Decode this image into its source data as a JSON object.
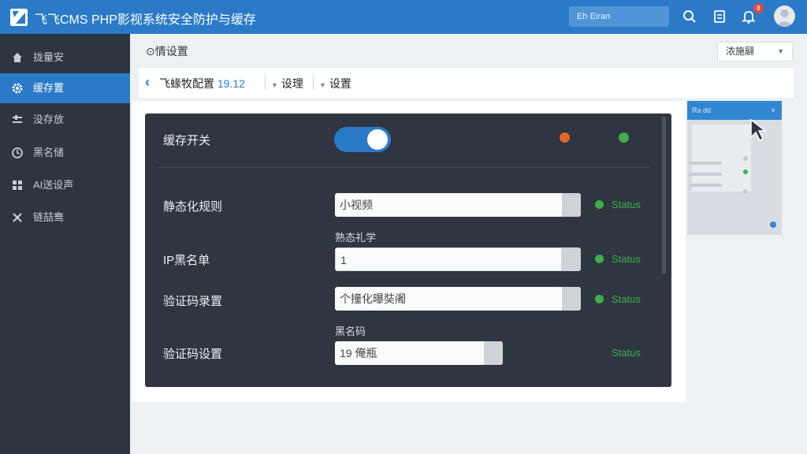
{
  "app": {
    "title": "飞飞CMS PHP影视系统安全防护与缓存"
  },
  "topbar": {
    "search_text": "Eh Eiran",
    "notification_count": "8"
  },
  "sidebar": {
    "items": [
      {
        "label": "拢量安",
        "icon": "home-icon",
        "active": false
      },
      {
        "label": "缓存置",
        "icon": "gear-icon",
        "active": true
      },
      {
        "label": "没存放",
        "icon": "sliders-icon",
        "active": false
      },
      {
        "label": "黑名储",
        "icon": "clock-icon",
        "active": false
      },
      {
        "label": "AI送设声",
        "icon": "grid-icon",
        "active": false
      },
      {
        "label": "链喆鸯",
        "icon": "tools-icon",
        "active": false
      }
    ]
  },
  "header": {
    "page_title": "⊙情设置",
    "select_value": "浓施翮",
    "breadcrumb": {
      "main": "飞蝝牧配置",
      "version": "19.12",
      "item1": "设理",
      "item2": "设置"
    }
  },
  "preview": {
    "head_text": "Ra dd"
  },
  "settings": {
    "cache_switch_label": "缓存开关",
    "cache_switch_on": true,
    "dots": {
      "left_color": "#e0642e",
      "right_color": "#3fae49"
    },
    "rows": [
      {
        "label": "静态化规则",
        "value": "小视频",
        "status": "Status",
        "sub_label": "熟态礼学"
      },
      {
        "label": "IP黑名单",
        "value": "1",
        "status": "Status"
      },
      {
        "label": "验证码录置",
        "value": "个撞化曝奘阇",
        "status": "Status",
        "sub_label": "黑名码"
      },
      {
        "label": "验证码设置",
        "value": "19 俺瓶",
        "status": "Status"
      }
    ]
  },
  "colors": {
    "accent": "#2a7ac7",
    "sidebar_bg": "#2d3540",
    "panel_bg": "#2f3641",
    "status_green": "#3fae49",
    "status_orange": "#e0642e"
  }
}
